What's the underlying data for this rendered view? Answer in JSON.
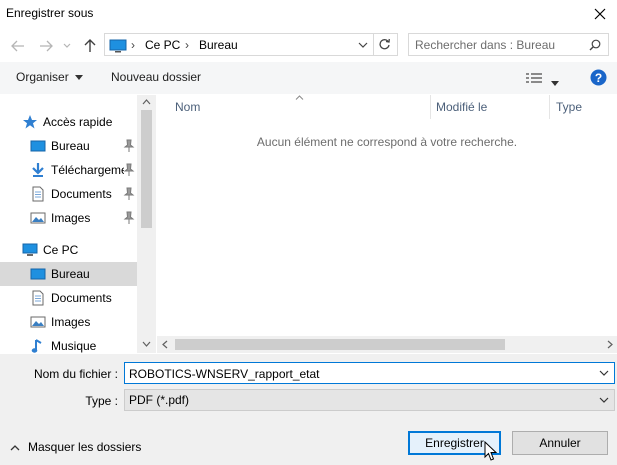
{
  "window": {
    "title": "Enregistrer sous"
  },
  "address": {
    "crumbs": [
      "Ce PC",
      "Bureau"
    ]
  },
  "search": {
    "placeholder": "Rechercher dans : Bureau"
  },
  "toolbar": {
    "organize": "Organiser",
    "new_folder": "Nouveau dossier"
  },
  "nav": {
    "quick_access": "Accès rapide",
    "quick_items": [
      {
        "label": "Bureau",
        "icon": "desktop-icon"
      },
      {
        "label": "Téléchargements",
        "icon": "download-icon"
      },
      {
        "label": "Documents",
        "icon": "document-icon"
      },
      {
        "label": "Images",
        "icon": "image-icon"
      }
    ],
    "this_pc": "Ce PC",
    "pc_items": [
      {
        "label": "Bureau",
        "icon": "desktop-icon",
        "selected": true
      },
      {
        "label": "Documents",
        "icon": "document-icon"
      },
      {
        "label": "Images",
        "icon": "image-icon"
      },
      {
        "label": "Musique",
        "icon": "music-icon"
      }
    ]
  },
  "columns": {
    "name": "Nom",
    "modified": "Modifié le",
    "type": "Type"
  },
  "files": {
    "empty_message": "Aucun élément ne correspond à votre recherche."
  },
  "form": {
    "filename_label": "Nom du fichier :",
    "filename_value": "ROBOTICS-WNSERV_rapport_etat",
    "type_label": "Type :",
    "type_value": "PDF (*.pdf)"
  },
  "buttons": {
    "save": "Enregistrer",
    "cancel": "Annuler",
    "hide_folders": "Masquer les dossiers"
  },
  "colors": {
    "accent": "#0078d7",
    "help": "#1a66c9",
    "selected_row": "#d9d9d9"
  }
}
